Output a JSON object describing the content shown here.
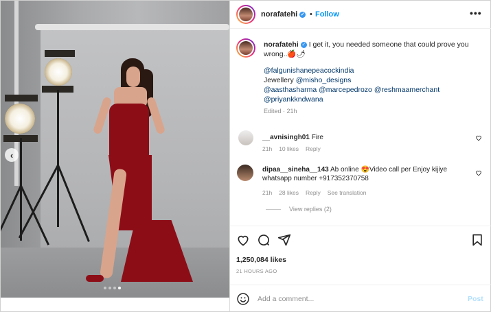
{
  "post": {
    "username": "norafatehi",
    "follow_label": "Follow",
    "more_label": "•••",
    "verified_glyph": "✓"
  },
  "caption": {
    "username": "norafatehi",
    "text": "I get it, you needed someone that could prove you wrong..🍎🌶",
    "tag1": "@falgunishanepeacockindia",
    "jewellery_label": "Jewellery",
    "tag2": "@misho_designs",
    "tag3": "@aasthasharma",
    "tag4": "@marcepedrozo",
    "tag5": "@reshmaamerchant",
    "tag6": "@priyankkndwana",
    "edited": "Edited",
    "time": "21h"
  },
  "comments": [
    {
      "username": "__avnisingh01",
      "text": "Fire",
      "time": "21h",
      "likes": "10 likes",
      "reply": "Reply"
    },
    {
      "username": "dipaa__sineha__143",
      "text": "Ab online 😍Video call per Enjoy kijiye whatsapp number +917352370758",
      "time": "21h",
      "likes": "28 likes",
      "reply": "Reply",
      "translate": "See translation"
    }
  ],
  "view_replies": "View replies (2)",
  "likes_count": "1,250,084 likes",
  "posted_ago": "21 HOURS AGO",
  "add_comment": {
    "placeholder": "Add a comment...",
    "post_label": "Post"
  },
  "photo": {
    "prev_arrow": "‹",
    "carousel_total": 4,
    "carousel_active": 4
  },
  "colors": {
    "accent": "#0095f6",
    "dress": "#8d0d17",
    "verified": "#3897f0"
  }
}
